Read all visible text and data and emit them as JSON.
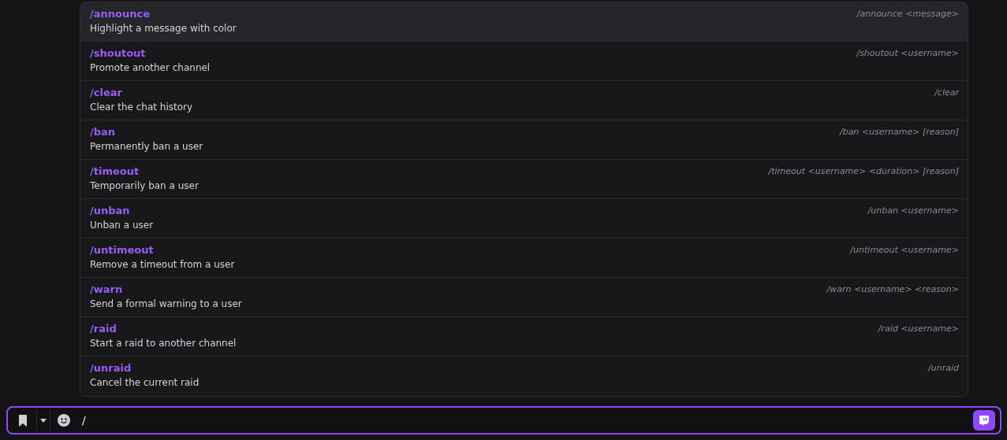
{
  "commands": [
    {
      "name": "/announce",
      "description": "Highlight a message with color",
      "usage": "/announce <message>",
      "selected": true
    },
    {
      "name": "/shoutout",
      "description": "Promote another channel",
      "usage": "/shoutout <username>",
      "selected": false
    },
    {
      "name": "/clear",
      "description": "Clear the chat history",
      "usage": "/clear",
      "selected": false
    },
    {
      "name": "/ban",
      "description": "Permanently ban a user",
      "usage": "/ban <username> [reason]",
      "selected": false
    },
    {
      "name": "/timeout",
      "description": "Temporarily ban a user",
      "usage": "/timeout <username> <duration> [reason]",
      "selected": false
    },
    {
      "name": "/unban",
      "description": "Unban a user",
      "usage": "/unban <username>",
      "selected": false
    },
    {
      "name": "/untimeout",
      "description": "Remove a timeout from a user",
      "usage": "/untimeout <username>",
      "selected": false
    },
    {
      "name": "/warn",
      "description": "Send a formal warning to a user",
      "usage": "/warn <username> <reason>",
      "selected": false
    },
    {
      "name": "/raid",
      "description": "Start a raid to another channel",
      "usage": "/raid <username>",
      "selected": false
    },
    {
      "name": "/unraid",
      "description": "Cancel the current raid",
      "usage": "/unraid",
      "selected": false
    }
  ],
  "chat_input": {
    "value": "/"
  }
}
